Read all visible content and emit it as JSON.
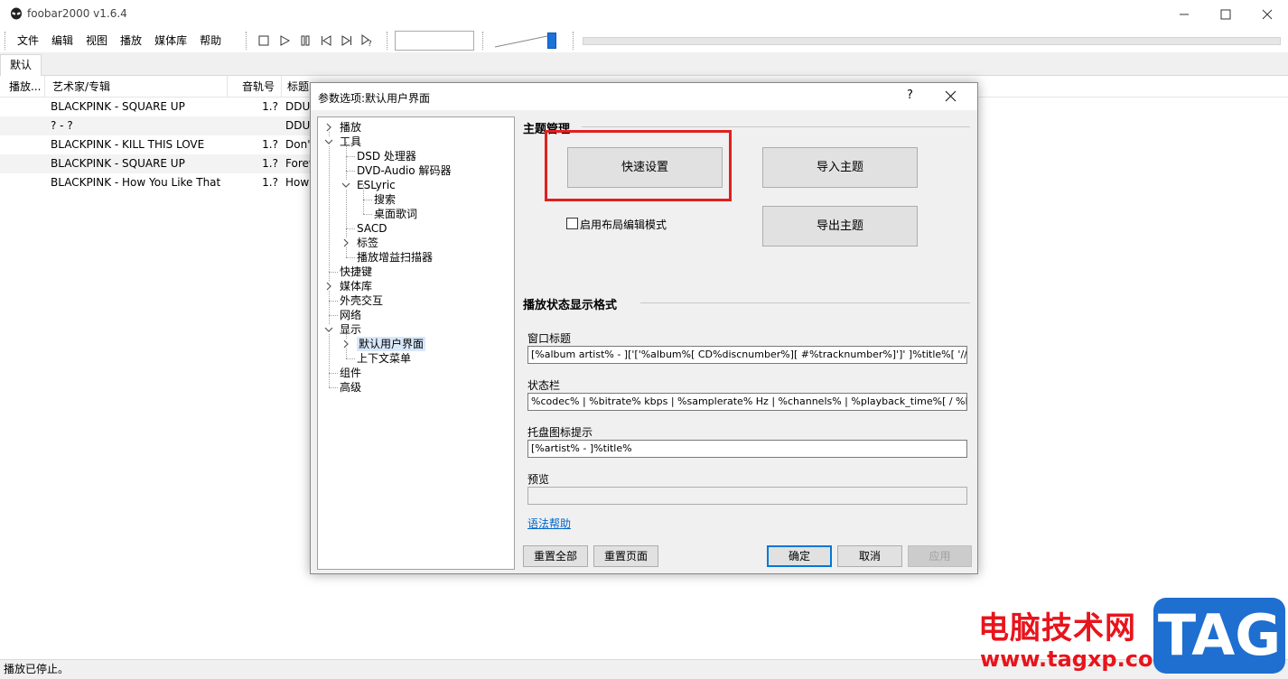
{
  "window": {
    "title": "foobar2000 v1.6.4"
  },
  "menu": [
    "文件",
    "编辑",
    "视图",
    "播放",
    "媒体库",
    "帮助"
  ],
  "tabs": [
    "默认"
  ],
  "playlist": {
    "columns": [
      "播放...",
      "艺术家/专辑",
      "音轨号",
      "标题"
    ],
    "rows": [
      {
        "artist": "BLACKPINK - SQUARE UP",
        "track": "1.?",
        "title": "DDU"
      },
      {
        "artist": "? - ?",
        "track": "",
        "title": "DDU"
      },
      {
        "artist": "BLACKPINK - KILL THIS LOVE",
        "track": "1.?",
        "title": "Don'"
      },
      {
        "artist": "BLACKPINK - SQUARE UP",
        "track": "1.?",
        "title": "Forev"
      },
      {
        "artist": "BLACKPINK - How You Like That",
        "track": "1.?",
        "title": "How"
      }
    ]
  },
  "status": "播放已停止。",
  "dialog": {
    "title": "参数选项:默认用户界面",
    "help": "?",
    "tree": [
      {
        "label": "播放",
        "level": 0,
        "expander": "collapsed"
      },
      {
        "label": "工具",
        "level": 0,
        "expander": "expanded"
      },
      {
        "label": "DSD 处理器",
        "level": 1,
        "expander": "none"
      },
      {
        "label": "DVD-Audio 解码器",
        "level": 1,
        "expander": "none"
      },
      {
        "label": "ESLyric",
        "level": 1,
        "expander": "expanded"
      },
      {
        "label": "搜索",
        "level": 2,
        "expander": "none"
      },
      {
        "label": "桌面歌词",
        "level": 2,
        "expander": "none"
      },
      {
        "label": "SACD",
        "level": 1,
        "expander": "none"
      },
      {
        "label": "标签",
        "level": 1,
        "expander": "collapsed"
      },
      {
        "label": "播放增益扫描器",
        "level": 1,
        "expander": "none"
      },
      {
        "label": "快捷键",
        "level": 0,
        "expander": "none"
      },
      {
        "label": "媒体库",
        "level": 0,
        "expander": "collapsed"
      },
      {
        "label": "外壳交互",
        "level": 0,
        "expander": "none"
      },
      {
        "label": "网络",
        "level": 0,
        "expander": "none"
      },
      {
        "label": "显示",
        "level": 0,
        "expander": "expanded"
      },
      {
        "label": "默认用户界面",
        "level": 1,
        "expander": "collapsed",
        "selected": true
      },
      {
        "label": "上下文菜单",
        "level": 1,
        "expander": "none"
      },
      {
        "label": "组件",
        "level": 0,
        "expander": "none"
      },
      {
        "label": "高级",
        "level": 0,
        "expander": "none"
      }
    ],
    "theme": {
      "title": "主题管理",
      "quick_setup": "快速设置",
      "import": "导入主题",
      "export": "导出主题",
      "layout_edit": "启用布局编辑模式"
    },
    "format": {
      "title": "播放状态显示格式",
      "window_title_label": "窗口标题",
      "window_title_value": "[%album artist% - ]['['%album%[ CD%discnumber%][ #%tracknumber%]']' ]%title%[ '//' %track a",
      "statusbar_label": "状态栏",
      "statusbar_value": "%codec% | %bitrate% kbps | %samplerate% Hz | %channels% | %playback_time%[ / %length%",
      "tray_label": "托盘图标提示",
      "tray_value": "[%artist% - ]%title%",
      "preview_label": "预览",
      "preview_value": "",
      "syntax_help": "语法帮助"
    },
    "buttons": {
      "reset_all": "重置全部",
      "reset_page": "重置页面",
      "ok": "确定",
      "cancel": "取消",
      "apply": "应用"
    }
  },
  "watermark": {
    "text": "电脑技术网",
    "url": "www.tagxp.com",
    "tag": "TAG"
  },
  "colors": {
    "accent": "#1a73d9",
    "highlight_box": "#e02020",
    "watermark_red": "#e8141c",
    "watermark_blue": "#1e6fd0"
  }
}
